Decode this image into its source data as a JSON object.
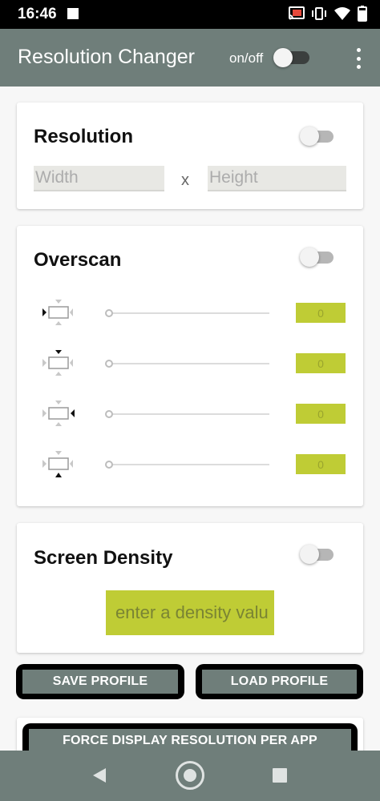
{
  "status_bar": {
    "time": "16:46",
    "icons": [
      "notification-square-icon",
      "cast-icon",
      "vibrate-icon",
      "wifi-icon",
      "battery-icon"
    ]
  },
  "app_bar": {
    "title": "Resolution Changer",
    "toggle_label": "on/off",
    "toggle_on": false,
    "menu_icon": "more-vert-icon"
  },
  "resolution": {
    "title": "Resolution",
    "enabled": false,
    "width_placeholder": "Width",
    "separator": "x",
    "height_placeholder": "Height"
  },
  "overscan": {
    "title": "Overscan",
    "enabled": false,
    "rows": [
      {
        "side": "left",
        "icon": "overscan-left-icon",
        "value": "0"
      },
      {
        "side": "top",
        "icon": "overscan-top-icon",
        "value": "0"
      },
      {
        "side": "right",
        "icon": "overscan-right-icon",
        "value": "0"
      },
      {
        "side": "bottom",
        "icon": "overscan-bottom-icon",
        "value": "0"
      }
    ]
  },
  "density": {
    "title": "Screen Density",
    "enabled": false,
    "placeholder": "enter a density valu"
  },
  "buttons": {
    "save": "SAVE PROFILE",
    "load": "LOAD PROFILE",
    "force": "FORCE DISPLAY RESOLUTION PER APP"
  },
  "nav": {
    "back_icon": "back-icon",
    "home_icon": "home-icon",
    "recents_icon": "recents-icon"
  },
  "colors": {
    "app_bar": "#6f7e7a",
    "accent_field": "#bfcc35",
    "background": "#f7f7f7"
  }
}
